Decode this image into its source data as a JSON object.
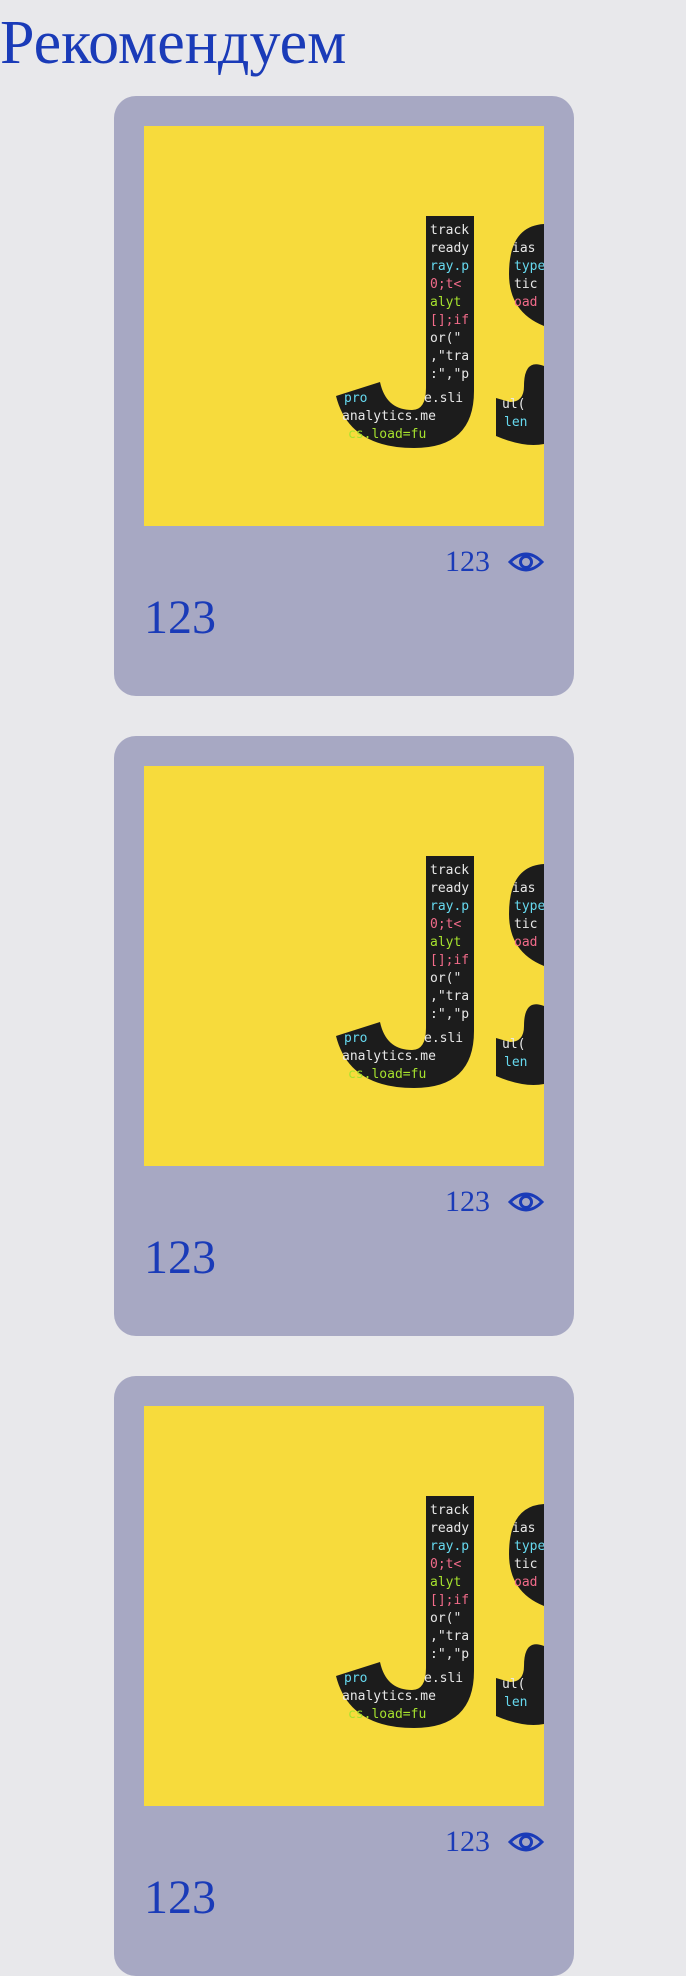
{
  "page": {
    "title": "Рекомендуем",
    "accent_color": "#1a3bb8",
    "card_bg": "#a7a8c3",
    "background": "#e8e8eb"
  },
  "cards": [
    {
      "title": "123",
      "views": "123",
      "thumbnail": {
        "description_icon": "javascript-logo-image",
        "color": "#f7db3c"
      },
      "views_icon": "eye-icon"
    },
    {
      "title": "123",
      "views": "123",
      "thumbnail": {
        "description_icon": "javascript-logo-image",
        "color": "#f7db3c"
      },
      "views_icon": "eye-icon"
    },
    {
      "title": "123",
      "views": "123",
      "thumbnail": {
        "description_icon": "javascript-logo-image",
        "color": "#f7db3c"
      },
      "views_icon": "eye-icon"
    }
  ]
}
